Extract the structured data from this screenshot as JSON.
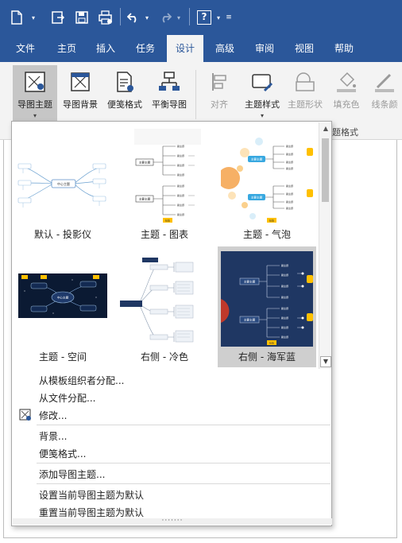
{
  "tabs": [
    {
      "label": "文件"
    },
    {
      "label": "主页"
    },
    {
      "label": "插入"
    },
    {
      "label": "任务"
    },
    {
      "label": "设计",
      "active": true
    },
    {
      "label": "高级"
    },
    {
      "label": "审阅"
    },
    {
      "label": "视图"
    },
    {
      "label": "帮助"
    }
  ],
  "quick_access": {
    "icons": [
      "new-doc-icon",
      "export-icon",
      "save-icon",
      "print-icon",
      "undo-icon",
      "redo-icon",
      "help-icon",
      "customize-icon"
    ],
    "help_label": "?"
  },
  "ribbon": {
    "buttons": [
      {
        "label": "导图主题",
        "icon": "map-theme-icon",
        "active": true,
        "has_dropdown": true
      },
      {
        "label": "导图背景",
        "icon": "map-background-icon"
      },
      {
        "label": "便笺格式",
        "icon": "note-format-icon"
      },
      {
        "label": "平衡导图",
        "icon": "balance-map-icon"
      },
      {
        "label": "对齐",
        "icon": "align-icon",
        "disabled": true
      },
      {
        "label": "主题样式",
        "icon": "topic-style-icon",
        "has_dropdown": true
      },
      {
        "label": "主题形状",
        "icon": "topic-shape-icon",
        "disabled": true
      },
      {
        "label": "填充色",
        "icon": "fill-color-icon",
        "disabled": true
      },
      {
        "label": "线条颜",
        "icon": "line-color-icon",
        "disabled": true
      }
    ],
    "group_label": "题格式"
  },
  "gallery": {
    "themes": [
      {
        "label": "默认 - 投影仪",
        "style": "default"
      },
      {
        "label": "主题 - 图表",
        "style": "chart"
      },
      {
        "label": "主题 - 气泡",
        "style": "bubble"
      },
      {
        "label": "主题 - 空间",
        "style": "space"
      },
      {
        "label": "右侧 - 冷色",
        "style": "cool"
      },
      {
        "label": "右侧 - 海军蓝",
        "style": "navy",
        "selected": true
      }
    ],
    "thumb_text": {
      "center": "中心主题",
      "main": "主要主题",
      "sub": "副主题",
      "label": "标签"
    }
  },
  "menu": {
    "items": [
      {
        "label": "从模板组织者分配..."
      },
      {
        "label": "从文件分配..."
      },
      {
        "label": "修改...",
        "icon": "modify-theme-icon"
      },
      {
        "label": "背景..."
      },
      {
        "label": "便笺格式..."
      },
      {
        "label": "添加导图主题..."
      },
      {
        "label": "设置当前导图主题为默认"
      },
      {
        "label": "重置当前导图主题为默认"
      }
    ]
  },
  "colors": {
    "brand_blue": "#2b579a",
    "navy": "#1f3763",
    "space": "#0b1a33",
    "accent_yellow": "#ffc000",
    "bubble_orange": "#f4a24a"
  }
}
